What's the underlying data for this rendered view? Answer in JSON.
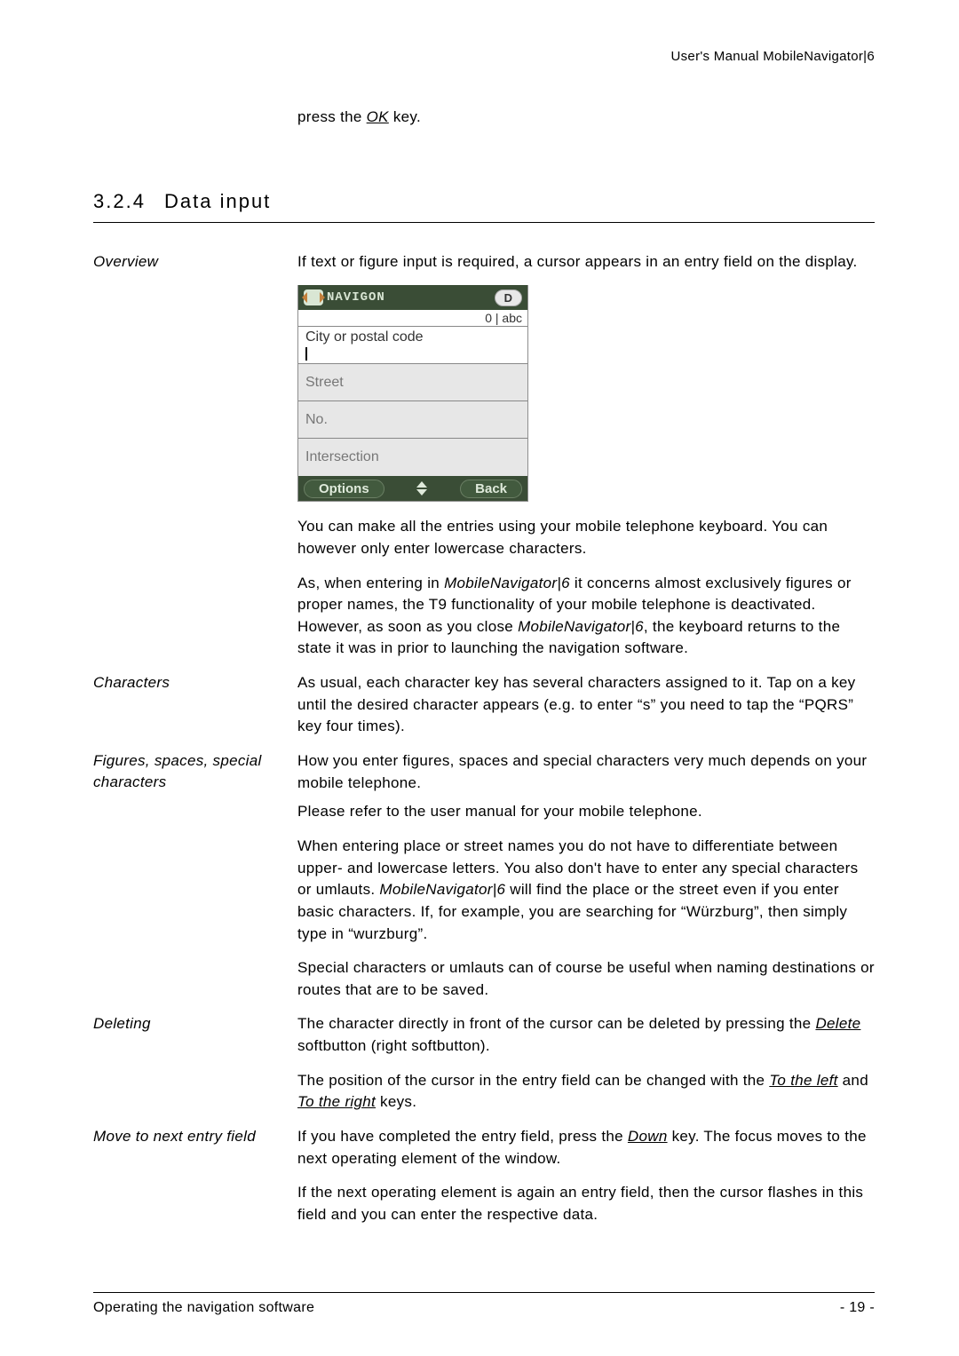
{
  "header": {
    "text": "User's Manual MobileNavigator|6"
  },
  "intro_line": {
    "pre": "press the ",
    "key": "OK",
    "post": " key."
  },
  "section": {
    "number": "3.2.4",
    "title": "Data input"
  },
  "overview": {
    "label": "Overview",
    "p1": "If text or figure input is required, a cursor appears in an entry field on the display.",
    "p2": "You can make all the entries using your mobile telephone keyboard. You can however only enter lowercase characters.",
    "p3_a": "As, when entering in ",
    "p3_em1": "MobileNavigator|6",
    "p3_b": " it concerns almost exclusively figures or proper names, the T9 functionality of your mobile telephone is deactivated. However, as soon as you close ",
    "p3_em2": "MobileNavigator|6",
    "p3_c": ", the keyboard returns to the state it was in prior to launching the navigation software."
  },
  "device": {
    "brand": "NAVIGON",
    "badge": "D",
    "mode": "0 | abc",
    "field_city": "City or postal code",
    "field_street": "Street",
    "field_no": "No.",
    "field_intersection": "Intersection",
    "soft_left": "Options",
    "soft_right": "Back"
  },
  "characters": {
    "label": "Characters",
    "p1": "As usual, each character key has several characters assigned to it. Tap on a key until the desired character appears (e.g. to enter “s” you need to tap the “PQRS” key four times)."
  },
  "figures": {
    "label": "Figures, spaces, special characters",
    "p1": "How you enter figures, spaces and special characters very much depends on your mobile telephone.",
    "p2": "Please refer to the user manual for your mobile telephone.",
    "p3_a": "When entering place or street names you do not have to differentiate between upper- and lowercase letters. You also don't have to enter any special characters or umlauts. ",
    "p3_em": "MobileNavigator|6",
    "p3_b": " will find the place or the street even if you enter basic characters. If, for example, you are searching for “Würzburg”, then simply type in “wurzburg”.",
    "p4": "Special characters or umlauts can of course be useful when naming destinations or routes that are to be saved."
  },
  "deleting": {
    "label": "Deleting",
    "p1_a": "The character directly in front of the cursor can be deleted by pressing the ",
    "p1_key": "Delete",
    "p1_b": " softbutton (right softbutton).",
    "p2_a": "The position of the cursor in the entry field can be changed with the ",
    "p2_k1": "To the left",
    "p2_mid": " and ",
    "p2_k2": "To the right",
    "p2_b": " keys."
  },
  "move_next": {
    "label": "Move to next entry field",
    "p1_a": "If you have completed the entry field, press the ",
    "p1_key": "Down",
    "p1_b": " key. The focus moves to the next operating element of the window.",
    "p2": "If the next operating element is again an entry field, then the cursor flashes in this field and you can enter the respective data."
  },
  "footer": {
    "left": "Operating the navigation software",
    "right": "- 19 -"
  }
}
